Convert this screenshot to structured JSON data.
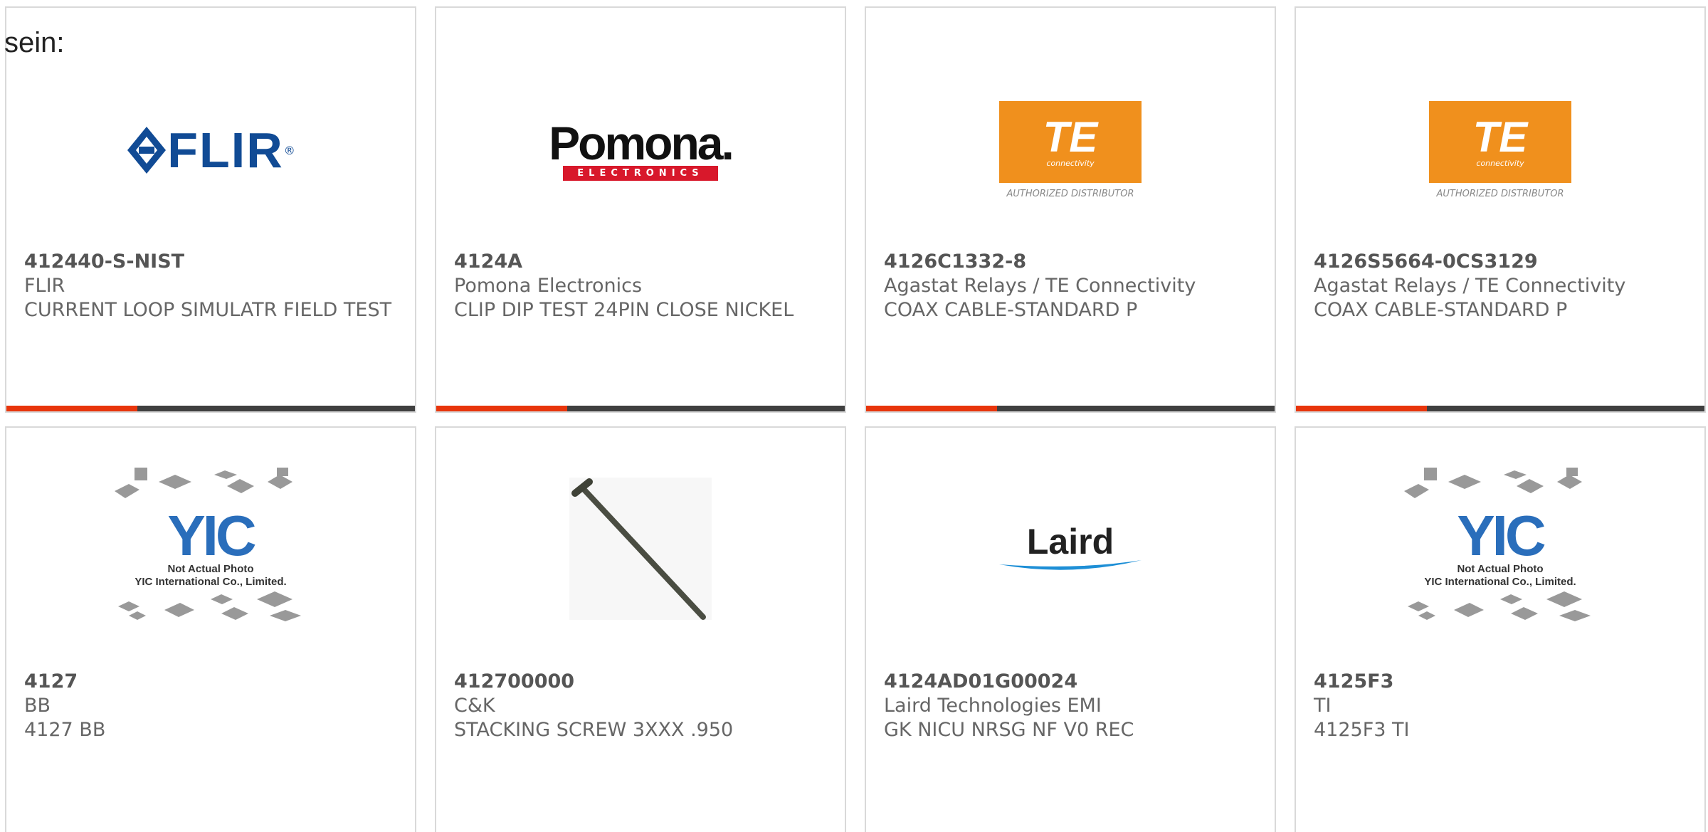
{
  "intro_text": "sein:",
  "colors": {
    "accent": "#e8350c",
    "bar": "#3f3f3f",
    "border": "#d9d9d9",
    "flir": "#114b95",
    "te": "#f0901d",
    "pomona_red": "#d8182b"
  },
  "products": [
    {
      "part_number": "412440-S-NIST",
      "manufacturer": "FLIR",
      "description": "CURRENT LOOP SIMULATR FIELD TEST",
      "logo": {
        "text": "FLIR",
        "mark": "®"
      }
    },
    {
      "part_number": "4124A",
      "manufacturer": "Pomona Electronics",
      "description": "CLIP DIP TEST 24PIN CLOSE NICKEL",
      "logo": {
        "text": "Pomona.",
        "sub": "ELECTRONICS"
      }
    },
    {
      "part_number": "4126C1332-8",
      "manufacturer": "Agastat Relays / TE Connectivity",
      "description": "COAX CABLE-STANDARD P",
      "logo": {
        "text": "TE",
        "sub": "connectivity",
        "caption": "AUTHORIZED DISTRIBUTOR"
      }
    },
    {
      "part_number": "4126S5664-0CS3129",
      "manufacturer": "Agastat Relays / TE Connectivity",
      "description": "COAX CABLE-STANDARD P",
      "logo": {
        "text": "TE",
        "sub": "connectivity",
        "caption": "AUTHORIZED DISTRIBUTOR"
      }
    },
    {
      "part_number": "4127",
      "manufacturer": "BB",
      "description": "4127 BB",
      "logo": {
        "text": "YIC",
        "note1": "Not Actual Photo",
        "note2": "YIC International Co., Limited."
      }
    },
    {
      "part_number": "412700000",
      "manufacturer": "C&K",
      "description": "STACKING SCREW 3XXX .950",
      "logo": {
        "icon": "stacking-screw-photo"
      }
    },
    {
      "part_number": "4124AD01G00024",
      "manufacturer": "Laird Technologies EMI",
      "description": "GK NICU NRSG NF V0 REC",
      "logo": {
        "text": "Laird",
        "mark": "™"
      }
    },
    {
      "part_number": "4125F3",
      "manufacturer": "TI",
      "description": "4125F3 TI",
      "logo": {
        "text": "YIC",
        "note1": "Not Actual Photo",
        "note2": "YIC International Co., Limited."
      }
    }
  ]
}
